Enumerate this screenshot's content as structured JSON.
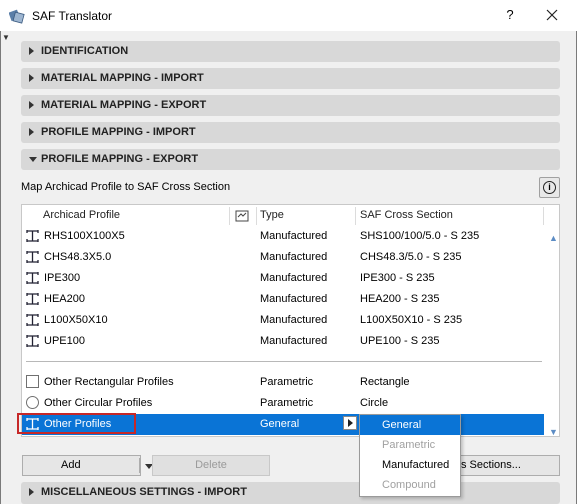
{
  "window": {
    "title": "SAF Translator",
    "help_label": "?",
    "close_label": "✕"
  },
  "sections_top": [
    {
      "label": "IDENTIFICATION",
      "expanded": false
    },
    {
      "label": "MATERIAL MAPPING - IMPORT",
      "expanded": false
    },
    {
      "label": "MATERIAL MAPPING - EXPORT",
      "expanded": false
    },
    {
      "label": "PROFILE MAPPING - IMPORT",
      "expanded": false
    },
    {
      "label": "PROFILE MAPPING - EXPORT",
      "expanded": true
    }
  ],
  "mapping": {
    "subtitle": "Map Archicad Profile to SAF Cross Section",
    "info_label": "i",
    "columns": {
      "profile": "Archicad Profile",
      "type": "Type",
      "section": "SAF Cross Section"
    },
    "rows": [
      {
        "profile": "RHS100X100X5",
        "type": "Manufactured",
        "section": "SHS100/100/5.0 - S 235"
      },
      {
        "profile": "CHS48.3X5.0",
        "type": "Manufactured",
        "section": "CHS48.3/5.0 - S 235"
      },
      {
        "profile": "IPE300",
        "type": "Manufactured",
        "section": "IPE300 - S 235"
      },
      {
        "profile": "HEA200",
        "type": "Manufactured",
        "section": "HEA200 - S 235"
      },
      {
        "profile": "L100X50X10",
        "type": "Manufactured",
        "section": "L100X50X10 - S 235"
      },
      {
        "profile": "UPE100",
        "type": "Manufactured",
        "section": "UPE100 - S 235"
      }
    ],
    "other_rows": [
      {
        "profile": "Other Rectangular Profiles",
        "type": "Parametric",
        "section": "Rectangle",
        "icon": "checkbox-icon"
      },
      {
        "profile": "Other Circular Profiles",
        "type": "Parametric",
        "section": "Circle",
        "icon": "radio-icon"
      },
      {
        "profile": "Other Profiles",
        "type": "General",
        "section": "",
        "icon": "i-beam-icon",
        "selected": true
      }
    ]
  },
  "type_menu": {
    "items": [
      {
        "label": "General",
        "state": "highlighted"
      },
      {
        "label": "Parametric",
        "state": "disabled"
      },
      {
        "label": "Manufactured",
        "state": "enabled"
      },
      {
        "label": "Compound",
        "state": "disabled"
      }
    ]
  },
  "buttons": {
    "add": "Add",
    "delete": "Delete",
    "sections": "s Sections..."
  },
  "section_bottom": {
    "label": "MISCELLANEOUS SETTINGS - IMPORT"
  },
  "colors": {
    "selection": "#0a74d6",
    "highlight_frame": "#c62828",
    "section_bar": "#d8d8d8"
  }
}
